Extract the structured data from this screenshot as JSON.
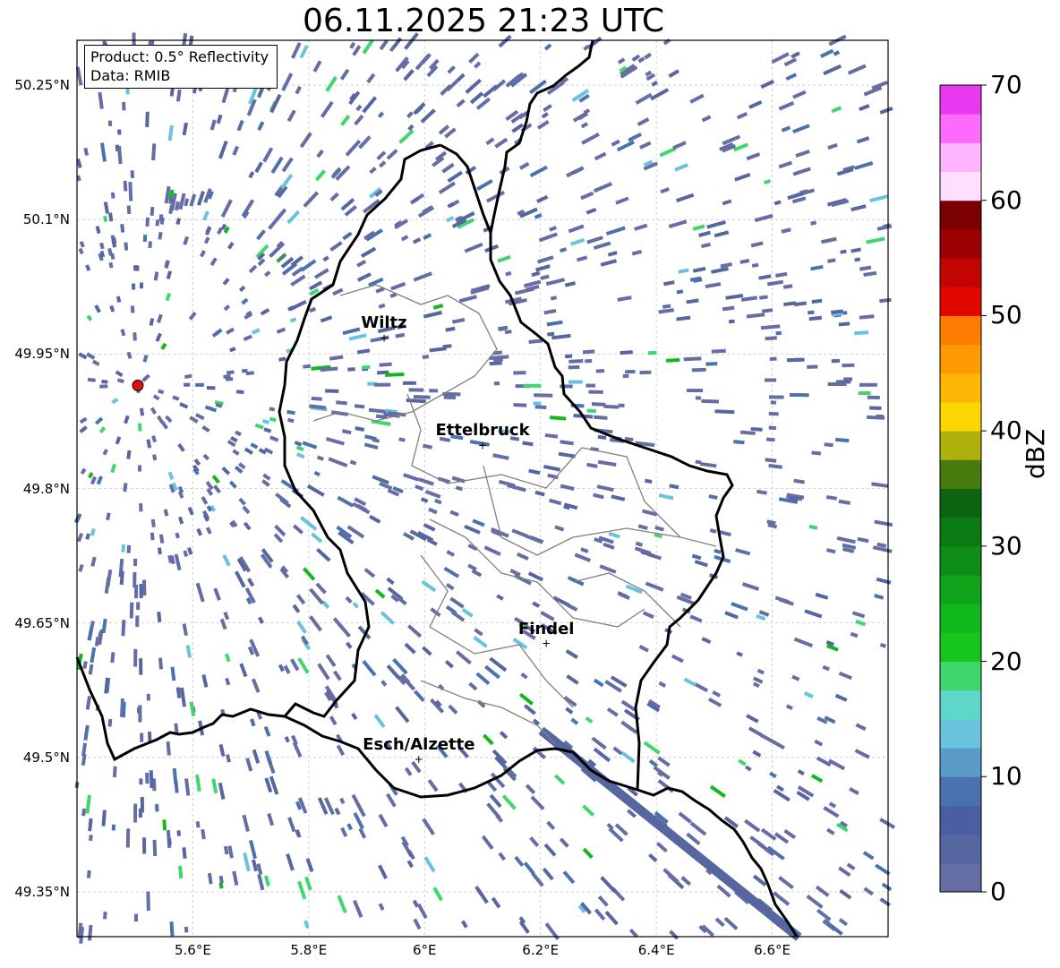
{
  "title": "06.11.2025 21:23 UTC",
  "info_box": {
    "product": "Product: 0.5° Reflectivity",
    "data": "Data: RMIB"
  },
  "lat_ticks": [
    {
      "value": 50.25,
      "label": "50.25°N"
    },
    {
      "value": 50.1,
      "label": "50.1°N"
    },
    {
      "value": 49.95,
      "label": "49.95°N"
    },
    {
      "value": 49.8,
      "label": "49.8°N"
    },
    {
      "value": 49.65,
      "label": "49.65°N"
    },
    {
      "value": 49.5,
      "label": "49.5°N"
    },
    {
      "value": 49.35,
      "label": "49.35°N"
    }
  ],
  "lon_ticks": [
    {
      "value": 5.6,
      "label": "5.6°E"
    },
    {
      "value": 5.8,
      "label": "5.8°E"
    },
    {
      "value": 6.0,
      "label": "6°E"
    },
    {
      "value": 6.2,
      "label": "6.2°E"
    },
    {
      "value": 6.4,
      "label": "6.4°E"
    },
    {
      "value": 6.6,
      "label": "6.6°E"
    }
  ],
  "extent": {
    "lon_min": 5.4,
    "lon_max": 6.8,
    "lat_min": 49.3,
    "lat_max": 50.3
  },
  "cities": [
    {
      "name": "Wiltz",
      "lon": 5.93,
      "lat": 49.968
    },
    {
      "name": "Ettelbruck",
      "lon": 6.1,
      "lat": 49.848
    },
    {
      "name": "Findel",
      "lon": 6.21,
      "lat": 49.627
    },
    {
      "name": "Esch/Alzette",
      "lon": 5.99,
      "lat": 49.498
    }
  ],
  "radar_site": {
    "lon": 5.505,
    "lat": 49.915,
    "color": "#e01010"
  },
  "colorbar": {
    "label": "dBZ",
    "min": 0,
    "max": 70,
    "step": 2.5,
    "ticks": [
      {
        "value": 0,
        "label": "0"
      },
      {
        "value": 10,
        "label": "10"
      },
      {
        "value": 20,
        "label": "20"
      },
      {
        "value": 30,
        "label": "30"
      },
      {
        "value": 40,
        "label": "40"
      },
      {
        "value": 50,
        "label": "50"
      },
      {
        "value": 60,
        "label": "60"
      },
      {
        "value": 70,
        "label": "70"
      }
    ],
    "colors": [
      "#646ea5",
      "#5566a0",
      "#4a5fa3",
      "#4a72ae",
      "#5b9bc8",
      "#69c3dc",
      "#5ed6c8",
      "#3fd66e",
      "#16c61a",
      "#10b81c",
      "#10a41b",
      "#0f8e17",
      "#0c7b14",
      "#0a6410",
      "#477b0e",
      "#aeb00b",
      "#fdd602",
      "#fdb604",
      "#fe9a01",
      "#fe7e01",
      "#e20600",
      "#c20402",
      "#9c0104",
      "#7b0000",
      "#fedffe",
      "#feb4fe",
      "#fd6afc",
      "#e838f0"
    ]
  }
}
